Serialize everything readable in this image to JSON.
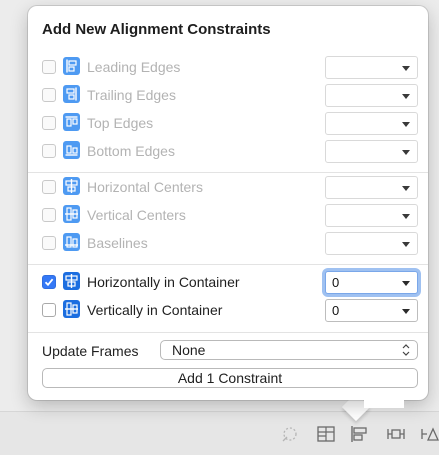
{
  "popover": {
    "title": "Add New Alignment Constraints",
    "rows": [
      {
        "label": "Leading Edges",
        "checked": false,
        "enabled": false,
        "value": "",
        "icon": "leading-edges-icon"
      },
      {
        "label": "Trailing Edges",
        "checked": false,
        "enabled": false,
        "value": "",
        "icon": "trailing-edges-icon"
      },
      {
        "label": "Top Edges",
        "checked": false,
        "enabled": false,
        "value": "",
        "icon": "top-edges-icon"
      },
      {
        "label": "Bottom Edges",
        "checked": false,
        "enabled": false,
        "value": "",
        "icon": "bottom-edges-icon"
      },
      {
        "label": "Horizontal Centers",
        "checked": false,
        "enabled": false,
        "value": "",
        "icon": "horizontal-centers-icon"
      },
      {
        "label": "Vertical Centers",
        "checked": false,
        "enabled": false,
        "value": "",
        "icon": "vertical-centers-icon"
      },
      {
        "label": "Baselines",
        "checked": false,
        "enabled": false,
        "value": "",
        "icon": "baselines-icon"
      },
      {
        "label": "Horizontally in Container",
        "checked": true,
        "enabled": true,
        "value": "0",
        "icon": "horizontally-in-container-icon"
      },
      {
        "label": "Vertically in Container",
        "checked": false,
        "enabled": true,
        "value": "0",
        "icon": "vertically-in-container-icon"
      }
    ],
    "update_frames": {
      "label": "Update Frames",
      "value": "None"
    },
    "add_button": "Add 1 Constraint"
  },
  "colors": {
    "accent": "#3478f6",
    "icon_blue": "#1c6ee0",
    "disabled_text": "#b3b3b3"
  },
  "toolbar": {
    "icons": [
      "update-frames-icon",
      "stack-icon",
      "align-icon",
      "add-constraints-icon",
      "resolve-issues-icon"
    ]
  }
}
